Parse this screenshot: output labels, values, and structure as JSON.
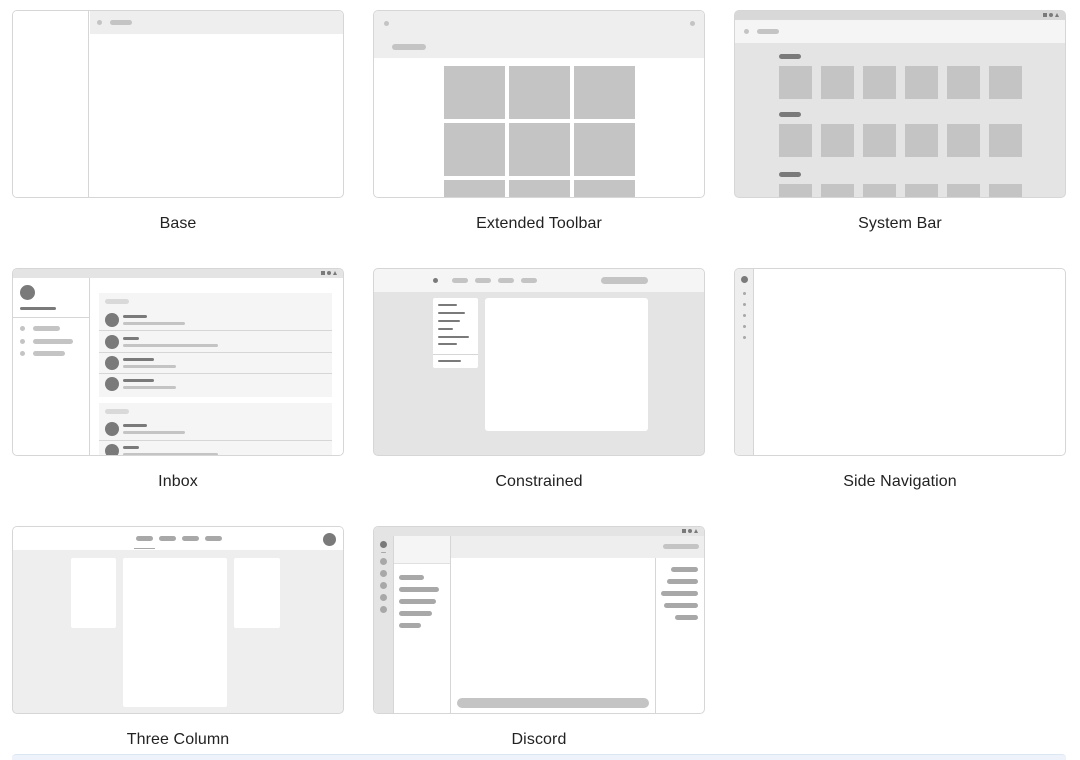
{
  "colors": {
    "border": "#d6d6d6",
    "bar": "#eeeeee",
    "light": "#f5f5f5",
    "mid": "#c4c4c4",
    "placeholder": "#d2d2d2",
    "dark": "#7a7a7a",
    "bg_gray": "#e4e4e4",
    "text": "#222222"
  },
  "layouts": [
    {
      "id": "base",
      "label": "Base"
    },
    {
      "id": "extended-toolbar",
      "label": "Extended Toolbar"
    },
    {
      "id": "system-bar",
      "label": "System Bar"
    },
    {
      "id": "inbox",
      "label": "Inbox"
    },
    {
      "id": "constrained",
      "label": "Constrained"
    },
    {
      "id": "side-navigation",
      "label": "Side Navigation"
    },
    {
      "id": "three-column",
      "label": "Three Column"
    },
    {
      "id": "discord",
      "label": "Discord"
    }
  ],
  "system_bar_icons": [
    "square-icon",
    "circle-icon",
    "triangle-icon"
  ]
}
